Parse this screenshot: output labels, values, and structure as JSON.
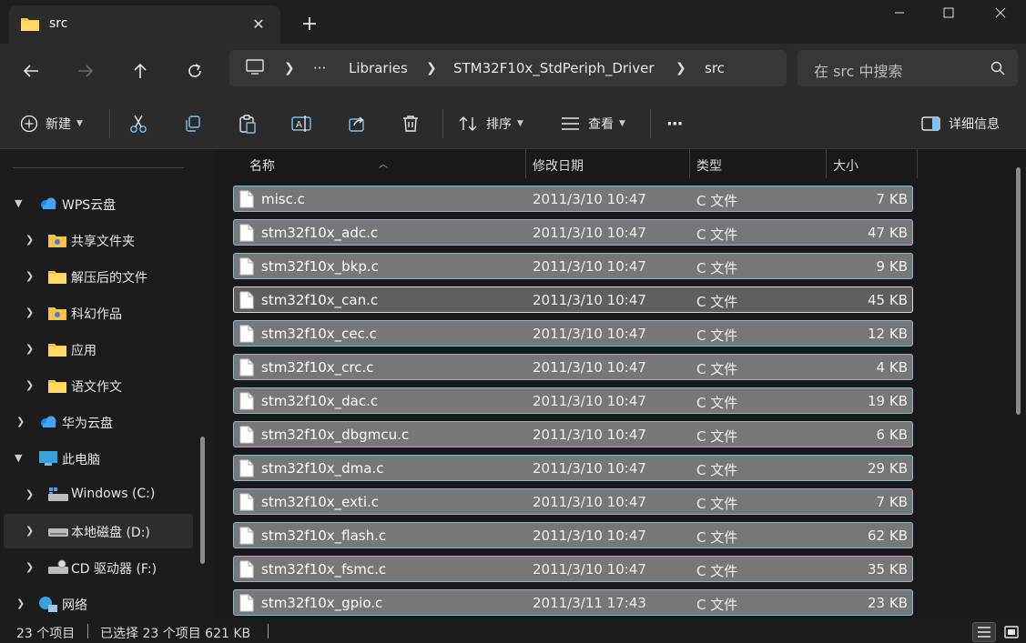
{
  "window": {
    "tab_title": "src",
    "new_tab_symbol": "+",
    "close_symbol": "✕"
  },
  "address": {
    "ellipsis": "···",
    "segments": [
      "Libraries",
      "STM32F10x_StdPeriph_Driver",
      "src"
    ],
    "search_placeholder": "在 src 中搜索"
  },
  "toolbar": {
    "new_label": "新建",
    "sort_label": "排序",
    "view_label": "查看",
    "more": "···",
    "details_label": "详细信息"
  },
  "sidebar": {
    "items": [
      {
        "label": "WPS云盘"
      },
      {
        "label": "共享文件夹"
      },
      {
        "label": "解压后的文件"
      },
      {
        "label": "科幻作品"
      },
      {
        "label": "应用"
      },
      {
        "label": "语文作文"
      },
      {
        "label": "华为云盘"
      },
      {
        "label": "此电脑"
      },
      {
        "label": "Windows (C:)"
      },
      {
        "label": "本地磁盘 (D:)"
      },
      {
        "label": "CD 驱动器 (F:)"
      },
      {
        "label": "网络"
      }
    ]
  },
  "columns": {
    "name": "名称",
    "date": "修改日期",
    "type": "类型",
    "size": "大小"
  },
  "files": [
    {
      "name": "misc.c",
      "date": "2011/3/10 10:47",
      "type": "C 文件",
      "size": "7 KB"
    },
    {
      "name": "stm32f10x_adc.c",
      "date": "2011/3/10 10:47",
      "type": "C 文件",
      "size": "47 KB"
    },
    {
      "name": "stm32f10x_bkp.c",
      "date": "2011/3/10 10:47",
      "type": "C 文件",
      "size": "9 KB"
    },
    {
      "name": "stm32f10x_can.c",
      "date": "2011/3/10 10:47",
      "type": "C 文件",
      "size": "45 KB"
    },
    {
      "name": "stm32f10x_cec.c",
      "date": "2011/3/10 10:47",
      "type": "C 文件",
      "size": "12 KB"
    },
    {
      "name": "stm32f10x_crc.c",
      "date": "2011/3/10 10:47",
      "type": "C 文件",
      "size": "4 KB"
    },
    {
      "name": "stm32f10x_dac.c",
      "date": "2011/3/10 10:47",
      "type": "C 文件",
      "size": "19 KB"
    },
    {
      "name": "stm32f10x_dbgmcu.c",
      "date": "2011/3/10 10:47",
      "type": "C 文件",
      "size": "6 KB"
    },
    {
      "name": "stm32f10x_dma.c",
      "date": "2011/3/10 10:47",
      "type": "C 文件",
      "size": "29 KB"
    },
    {
      "name": "stm32f10x_exti.c",
      "date": "2011/3/10 10:47",
      "type": "C 文件",
      "size": "7 KB"
    },
    {
      "name": "stm32f10x_flash.c",
      "date": "2011/3/10 10:47",
      "type": "C 文件",
      "size": "62 KB"
    },
    {
      "name": "stm32f10x_fsmc.c",
      "date": "2011/3/10 10:47",
      "type": "C 文件",
      "size": "35 KB"
    },
    {
      "name": "stm32f10x_gpio.c",
      "date": "2011/3/11 17:43",
      "type": "C 文件",
      "size": "23 KB"
    }
  ],
  "status": {
    "count": "23 个项目",
    "selected": "已选择 23 个项目  621 KB"
  },
  "colors": {
    "selection_fill": "#777777",
    "selection_border": "#8fb6d0",
    "folder": "#f5c34a"
  }
}
